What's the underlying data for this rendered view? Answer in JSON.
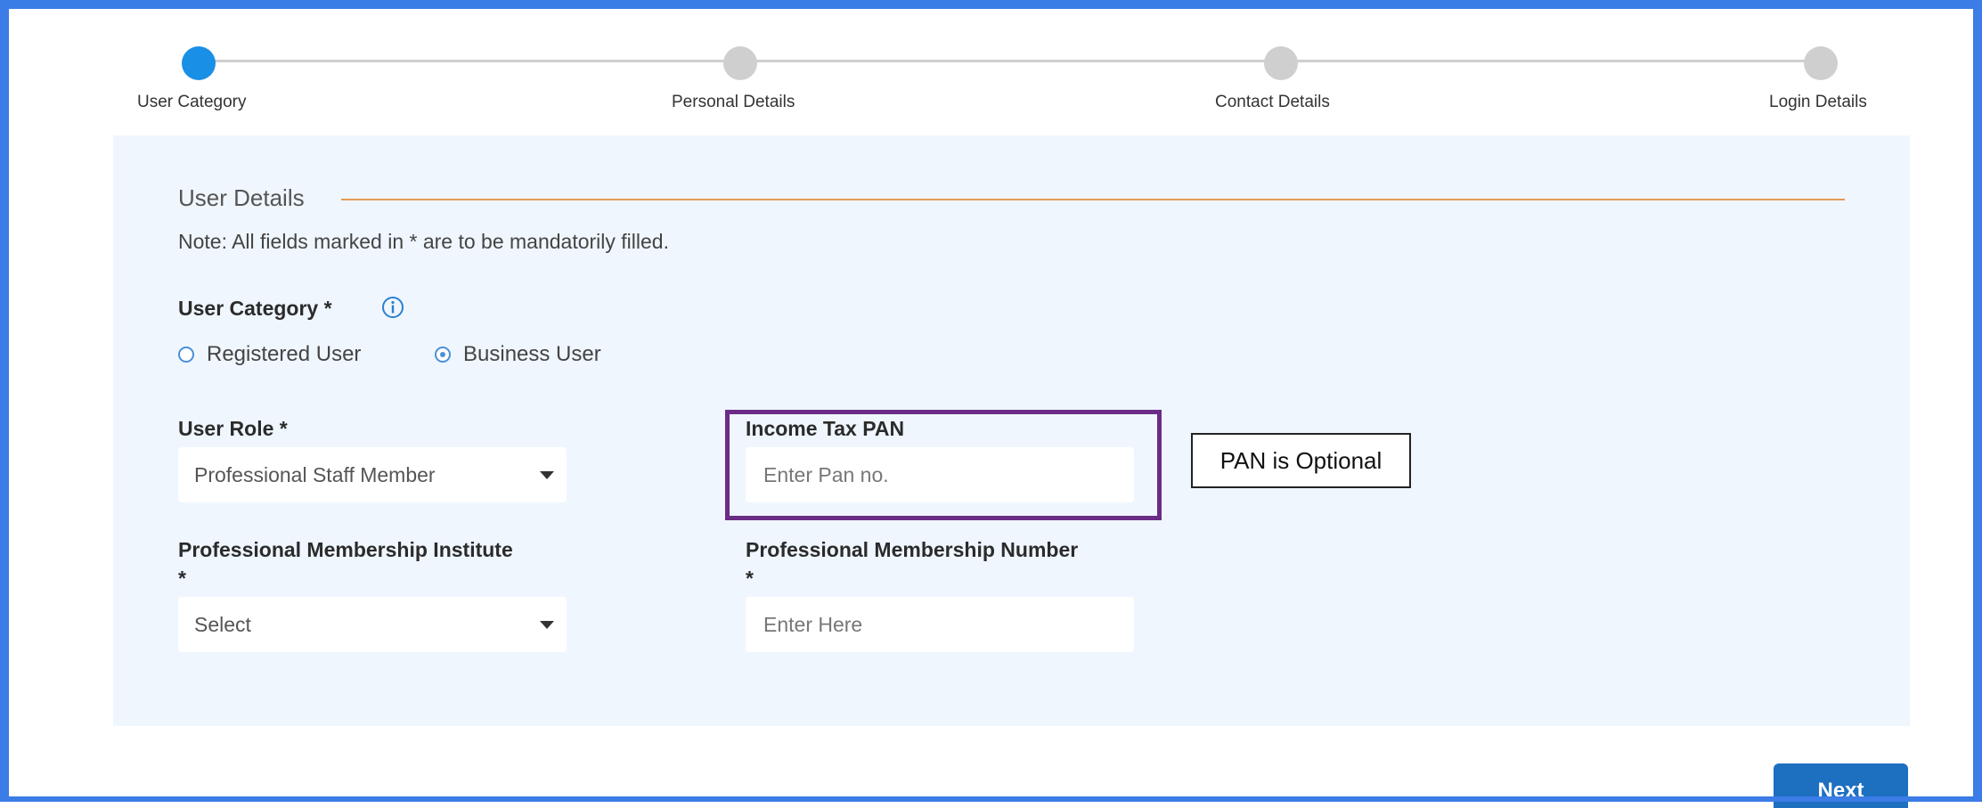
{
  "stepper": {
    "steps": [
      {
        "label": "User Category",
        "active": true
      },
      {
        "label": "Personal Details",
        "active": false
      },
      {
        "label": "Contact Details",
        "active": false
      },
      {
        "label": "Login Details",
        "active": false
      }
    ]
  },
  "form": {
    "section_title": "User Details",
    "note": "Note: All fields marked in * are to be mandatorily filled.",
    "user_category_label": "User Category *",
    "radio_registered": "Registered User",
    "radio_business": "Business User",
    "selected_category": "Business User",
    "user_role_label": "User Role *",
    "user_role_value": "Professional Staff Member",
    "pan_label": "Income Tax PAN",
    "pan_placeholder": "Enter Pan no.",
    "institute_label_line1": "Professional Membership Institute",
    "institute_label_line2": "*",
    "institute_value": "Select",
    "number_label_line1": "Professional Membership Number",
    "number_label_line2": "*",
    "number_placeholder": "Enter Here"
  },
  "annotation": {
    "callout_text": "PAN is Optional",
    "highlight_color": "#6b2c86"
  },
  "actions": {
    "next_label": "Next"
  },
  "colors": {
    "accent": "#1a8fe6",
    "frame": "#3b7ce6",
    "button": "#1d6fc0",
    "rule": "#e39a55"
  },
  "icons": {
    "info": "info-icon",
    "dropdown": "chevron-down-icon"
  }
}
